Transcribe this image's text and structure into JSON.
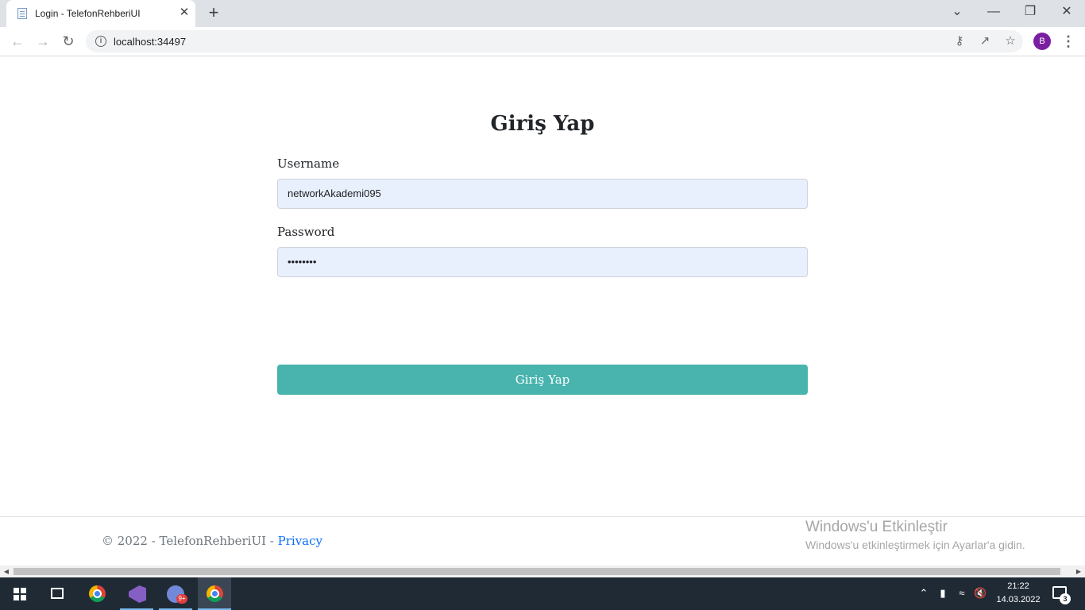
{
  "browser": {
    "tab_title": "Login - TelefonRehberiUI",
    "tab_close": "✕",
    "new_tab": "+",
    "url": "localhost:34497",
    "profile_initial": "B",
    "window_controls": {
      "tab_search": "⌄",
      "minimize": "—",
      "restore": "❐",
      "close": "✕"
    },
    "icons": [
      "back-arrow-icon",
      "forward-arrow-icon",
      "reload-icon",
      "site-info-icon",
      "key-icon",
      "share-icon",
      "star-icon",
      "kebab-menu-icon"
    ]
  },
  "page": {
    "heading": "Giriş Yap",
    "username_label": "Username",
    "username_value": "networkAkademi095",
    "password_label": "Password",
    "password_value": "••••••••",
    "submit_label": "Giriş Yap"
  },
  "footer": {
    "copyright": "© 2022 - TelefonRehberiUI - ",
    "privacy_link": "Privacy"
  },
  "watermark": {
    "title": "Windows'u Etkinleştir",
    "subtitle": "Windows'u etkinleştirmek için Ayarlar'a gidin."
  },
  "taskbar": {
    "apps": [
      "windows-start",
      "task-view",
      "chrome",
      "visual-studio",
      "discord",
      "chrome-active"
    ],
    "discord_badge": "9+",
    "time": "21:22",
    "date": "14.03.2022",
    "notification_count": "3"
  },
  "colors": {
    "accent_button": "#48b4ad",
    "input_autofill_bg": "#e8f0fe",
    "link": "#0d6efd",
    "avatar": "#7b1fa2",
    "taskbar": "#1f2a35"
  }
}
